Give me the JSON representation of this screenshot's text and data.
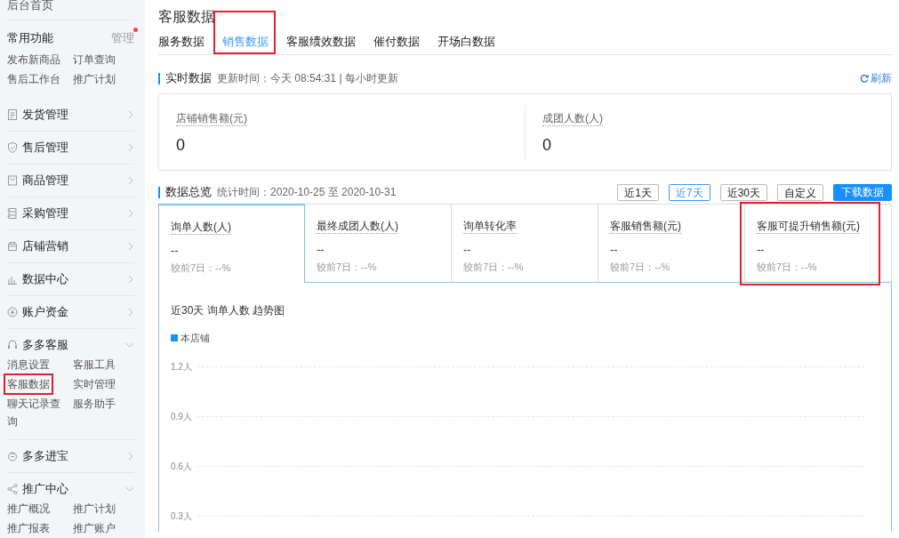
{
  "sidebar": {
    "home": "后台首页",
    "common": {
      "title": "常用功能",
      "manage": "管理",
      "manage_dot": true,
      "links": [
        {
          "label": "发布新商品",
          "highlighted": false
        },
        {
          "label": "订单查询",
          "highlighted": false
        },
        {
          "label": "售后工作台",
          "highlighted": false
        },
        {
          "label": "推广计划",
          "highlighted": false
        }
      ]
    },
    "sections": [
      {
        "label": "发货管理",
        "expanded": false
      },
      {
        "label": "售后管理",
        "expanded": false
      },
      {
        "label": "商品管理",
        "expanded": false
      },
      {
        "label": "采购管理",
        "expanded": false
      },
      {
        "label": "店铺营销",
        "expanded": false
      },
      {
        "label": "数据中心",
        "expanded": false
      },
      {
        "label": "账户资金",
        "expanded": false
      },
      {
        "label": "多多客服",
        "expanded": true,
        "children": [
          {
            "label": "消息设置",
            "highlighted": false
          },
          {
            "label": "客服工具",
            "highlighted": false
          },
          {
            "label": "客服数据",
            "highlighted": true
          },
          {
            "label": "实时管理",
            "highlighted": false
          },
          {
            "label": "聊天记录查询",
            "highlighted": false
          },
          {
            "label": "服务助手",
            "highlighted": false
          }
        ]
      },
      {
        "label": "多多进宝",
        "expanded": false
      },
      {
        "label": "推广中心",
        "expanded": true,
        "children": [
          {
            "label": "推广概况",
            "highlighted": false
          },
          {
            "label": "推广计划",
            "highlighted": false
          },
          {
            "label": "推广报表",
            "highlighted": false
          },
          {
            "label": "推广账户",
            "highlighted": false
          }
        ]
      }
    ]
  },
  "page_title": "客服数据",
  "tabs": [
    {
      "label": "服务数据",
      "selected": false,
      "highlighted": false
    },
    {
      "label": "销售数据",
      "selected": true,
      "highlighted": true
    },
    {
      "label": "客服绩效数据",
      "selected": false,
      "highlighted": false
    },
    {
      "label": "催付数据",
      "selected": false,
      "highlighted": false
    },
    {
      "label": "开场白数据",
      "selected": false,
      "highlighted": false
    }
  ],
  "realtime": {
    "title": "实时数据",
    "update": "更新时间：今天 08:54:31 | 每小时更新",
    "refresh": "刷新",
    "metrics": [
      {
        "label": "店铺销售额(元)",
        "value": "0"
      },
      {
        "label": "成团人数(人)",
        "value": "0"
      }
    ]
  },
  "overview": {
    "title": "数据总览",
    "period": "统计时间：2020-10-25 至 2020-10-31",
    "ranges": [
      {
        "label": "近1天",
        "selected": false
      },
      {
        "label": "近7天",
        "selected": true
      },
      {
        "label": "近30天",
        "selected": false
      },
      {
        "label": "自定义",
        "selected": false
      }
    ],
    "download": "下载数据",
    "metrics": [
      {
        "label": "询单人数(人)",
        "value": "--",
        "compare": "较前7日：--%",
        "selected": true,
        "highlighted": false
      },
      {
        "label": "最终成团人数(人)",
        "value": "--",
        "compare": "较前7日：--%",
        "selected": false,
        "highlighted": false
      },
      {
        "label": "询单转化率",
        "value": "--",
        "compare": "较前7日：--%",
        "selected": false,
        "highlighted": false
      },
      {
        "label": "客服销售额(元)",
        "value": "--",
        "compare": "较前7日：--%",
        "selected": false,
        "highlighted": false
      },
      {
        "label": "客服可提升销售额(元)",
        "value": "--",
        "compare": "较前7日：--%",
        "selected": false,
        "highlighted": true
      }
    ],
    "chart": {
      "title": "近30天 询单人数 趋势图",
      "legend": {
        "name": "本店铺",
        "color": "#1890ff"
      },
      "y_labels": [
        "1.2人",
        "0.9人",
        "0.6人",
        "0.3人"
      ]
    }
  }
}
